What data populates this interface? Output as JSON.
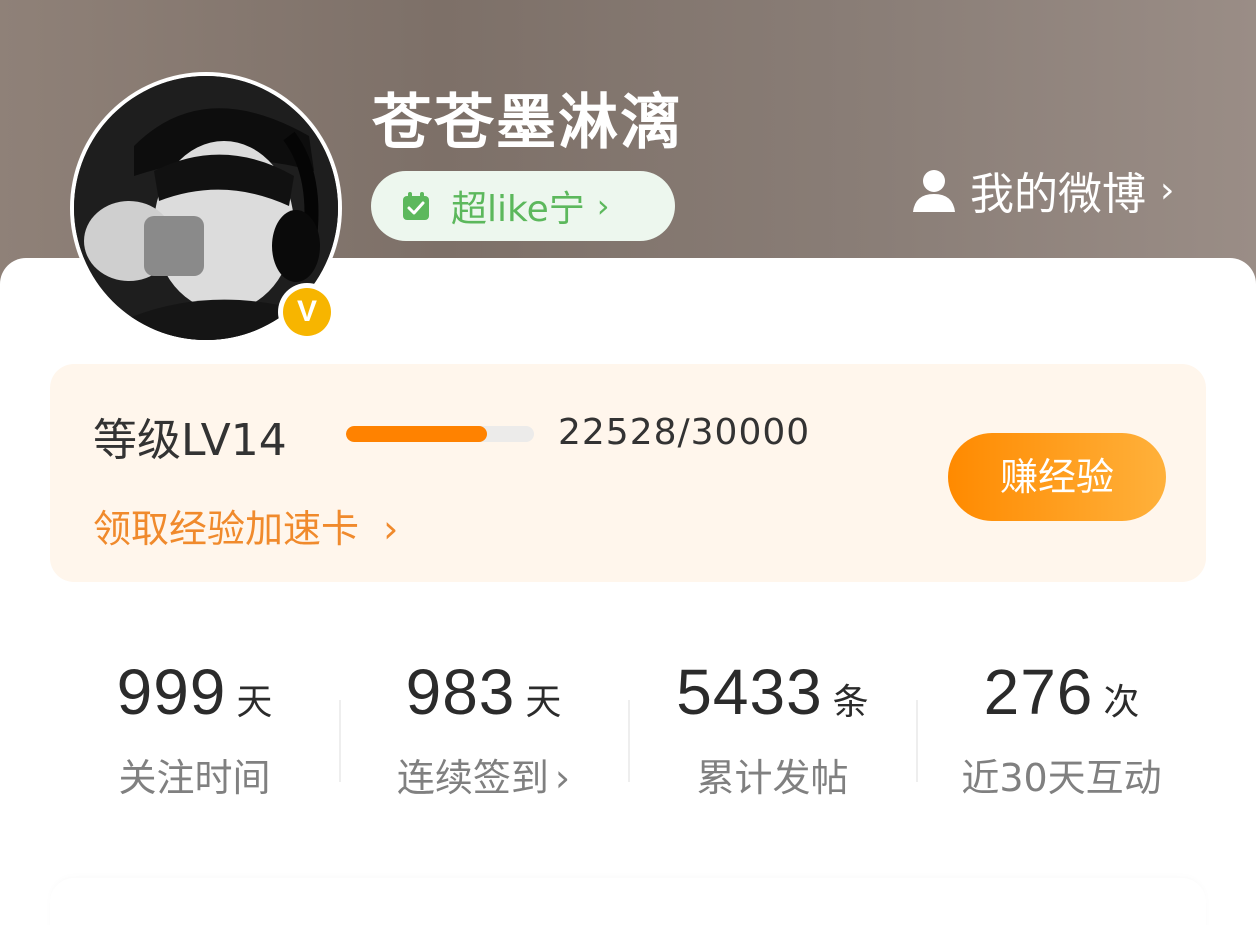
{
  "profile": {
    "username": "苍苍墨淋漓",
    "fan_group_label": "超like宁",
    "my_weibo_label": "我的微博",
    "vip_letter": "V",
    "fan_icon": "calendar-check-icon",
    "my_weibo_icon": "person-icon"
  },
  "level": {
    "label": "等级LV14",
    "exp_text": "22528/30000",
    "progress_fraction": 0.75,
    "boost_label": "领取经验加速卡",
    "earn_button_label": "赚经验"
  },
  "stats": [
    {
      "value": "999",
      "unit": "天",
      "label": "关注时间",
      "has_chevron": false
    },
    {
      "value": "983",
      "unit": "天",
      "label": "连续签到",
      "has_chevron": true
    },
    {
      "value": "5433",
      "unit": "条",
      "label": "累计发帖",
      "has_chevron": false
    },
    {
      "value": "276",
      "unit": "次",
      "label": "近30天互动",
      "has_chevron": false
    }
  ],
  "colors": {
    "accent_orange": "#ff8200",
    "fan_green": "#5cb85c",
    "vip_gold": "#f7b500"
  }
}
